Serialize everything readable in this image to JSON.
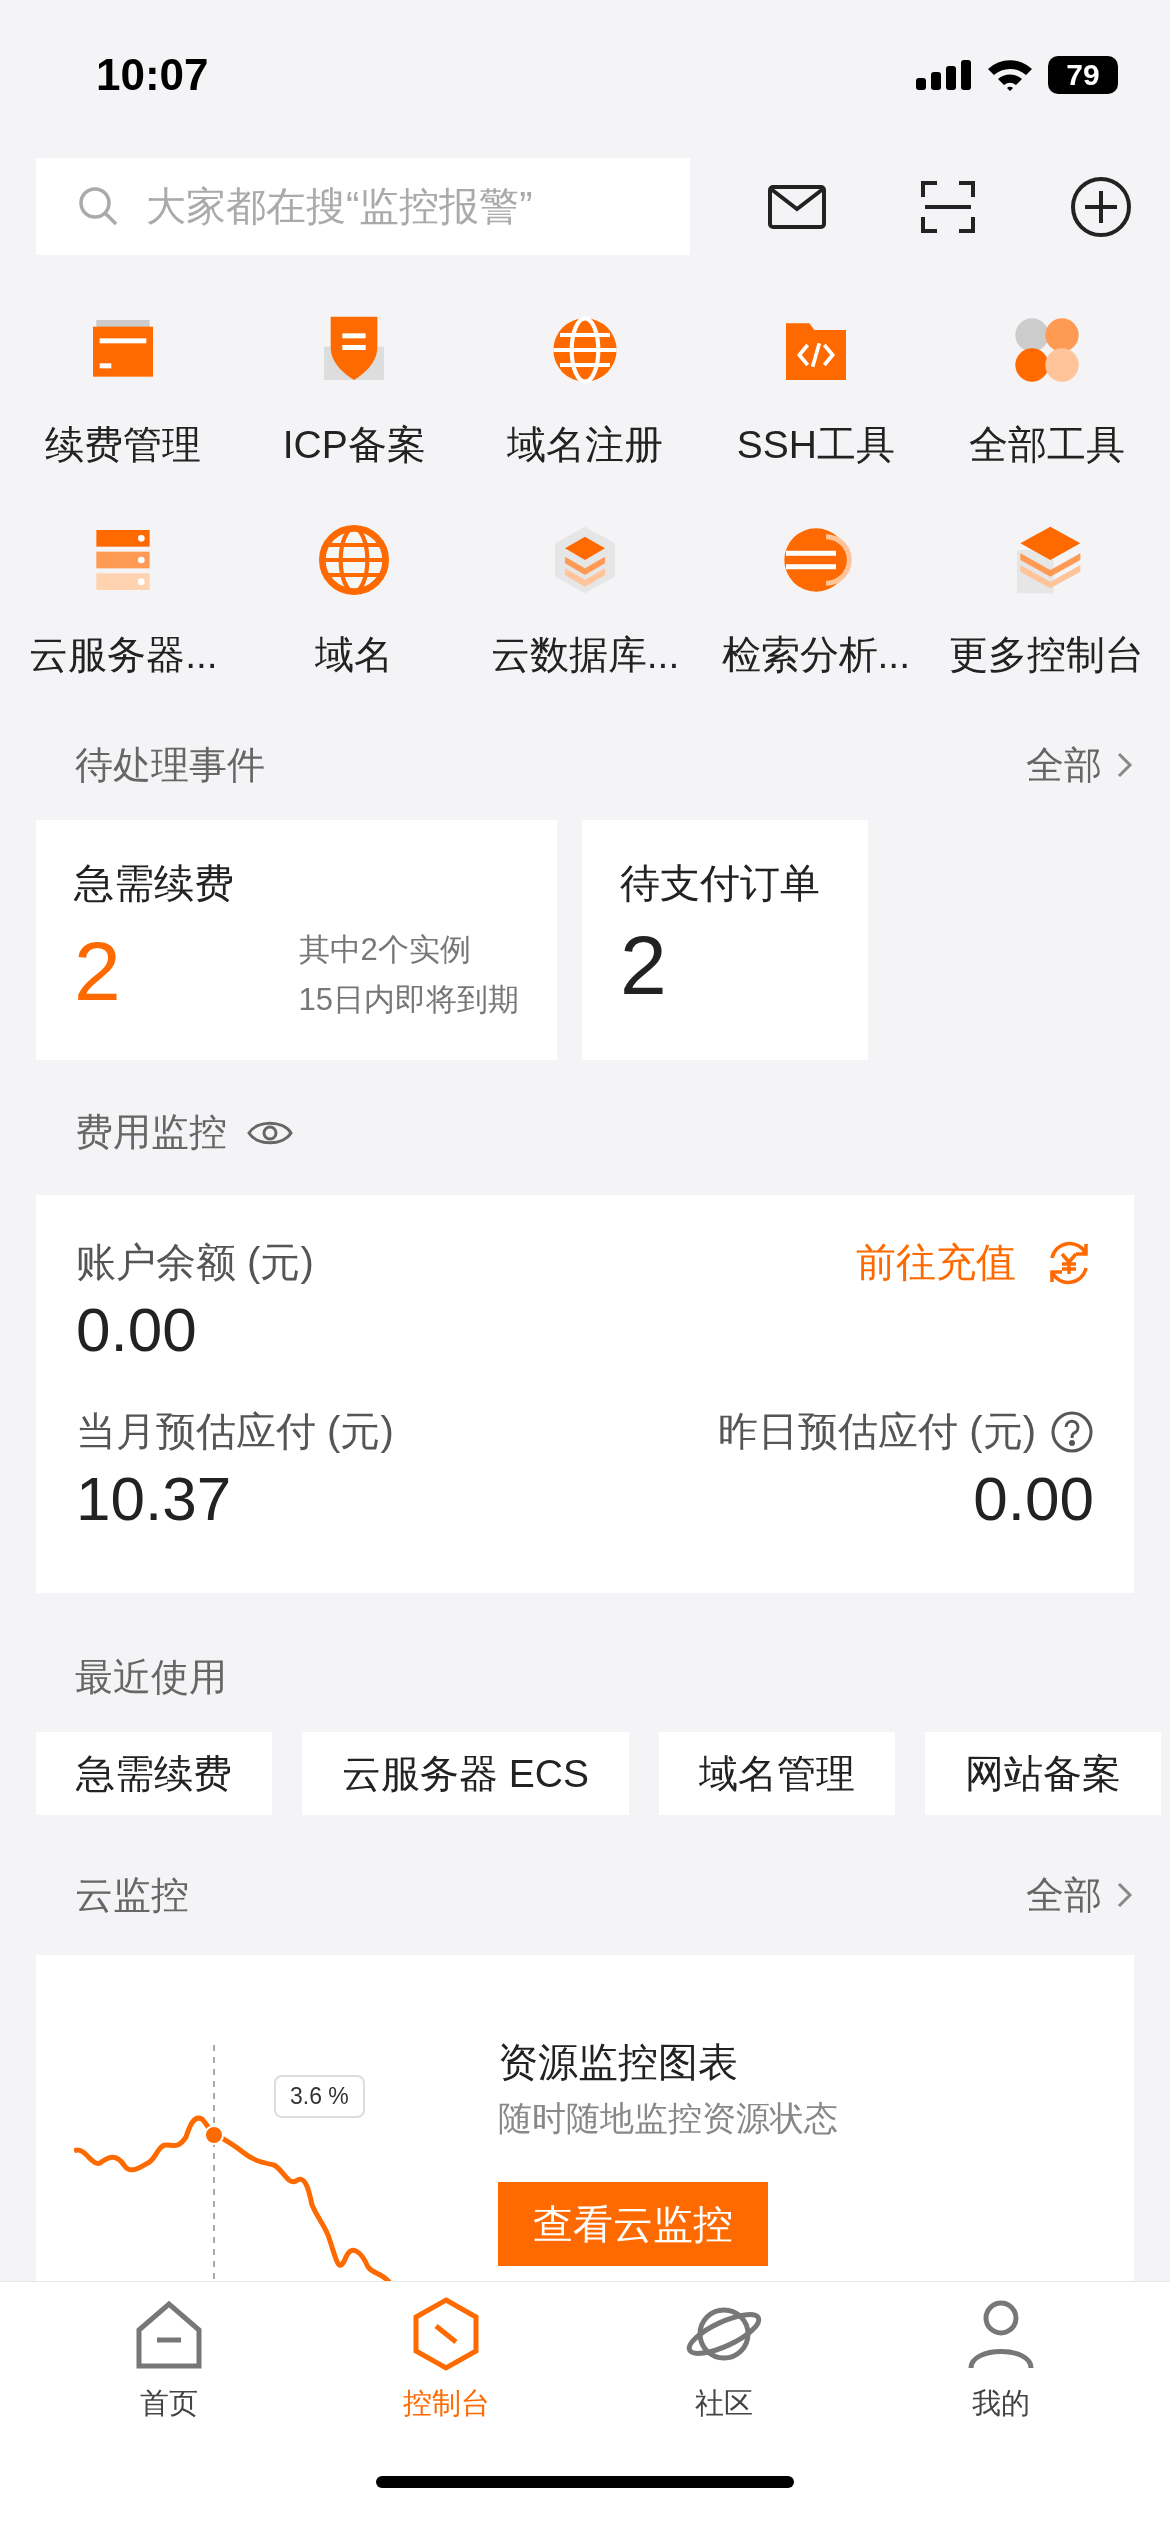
{
  "status_bar": {
    "time": "10:07",
    "battery": "79"
  },
  "search": {
    "placeholder": "大家都在搜“监控报警”"
  },
  "tools": [
    {
      "label": "续费管理"
    },
    {
      "label": "ICP备案"
    },
    {
      "label": "域名注册"
    },
    {
      "label": "SSH工具"
    },
    {
      "label": "全部工具"
    },
    {
      "label": "云服务器..."
    },
    {
      "label": "域名"
    },
    {
      "label": "云数据库..."
    },
    {
      "label": "检索分析..."
    },
    {
      "label": "更多控制台"
    }
  ],
  "pending": {
    "title": "待处理事件",
    "more": "全部",
    "cards": [
      {
        "title": "急需续费",
        "count": "2",
        "highlight": true,
        "note": [
          "其中2个实例",
          "15日内即将到期"
        ]
      },
      {
        "title": "待支付订单",
        "count": "2",
        "highlight": false
      }
    ]
  },
  "cost": {
    "title": "费用监控",
    "balance_label": "账户余额 (元)",
    "balance": "0.00",
    "recharge": "前往充值",
    "month_label": "当月预估应付 (元)",
    "month": "10.37",
    "yesterday_label": "昨日预估应付 (元)",
    "yesterday": "0.00"
  },
  "recent": {
    "title": "最近使用",
    "items": [
      "急需续费",
      "云服务器 ECS",
      "域名管理",
      "网站备案"
    ]
  },
  "monitor": {
    "title": "云监控",
    "more": "全部",
    "tooltip": "3.6 %",
    "heading": "资源监控图表",
    "subtitle": "随时随地监控资源状态",
    "button": "查看云监控"
  },
  "tabs": [
    {
      "label": "首页",
      "selected": false
    },
    {
      "label": "控制台",
      "selected": true
    },
    {
      "label": "社区",
      "selected": false
    },
    {
      "label": "我的",
      "selected": false
    }
  ]
}
